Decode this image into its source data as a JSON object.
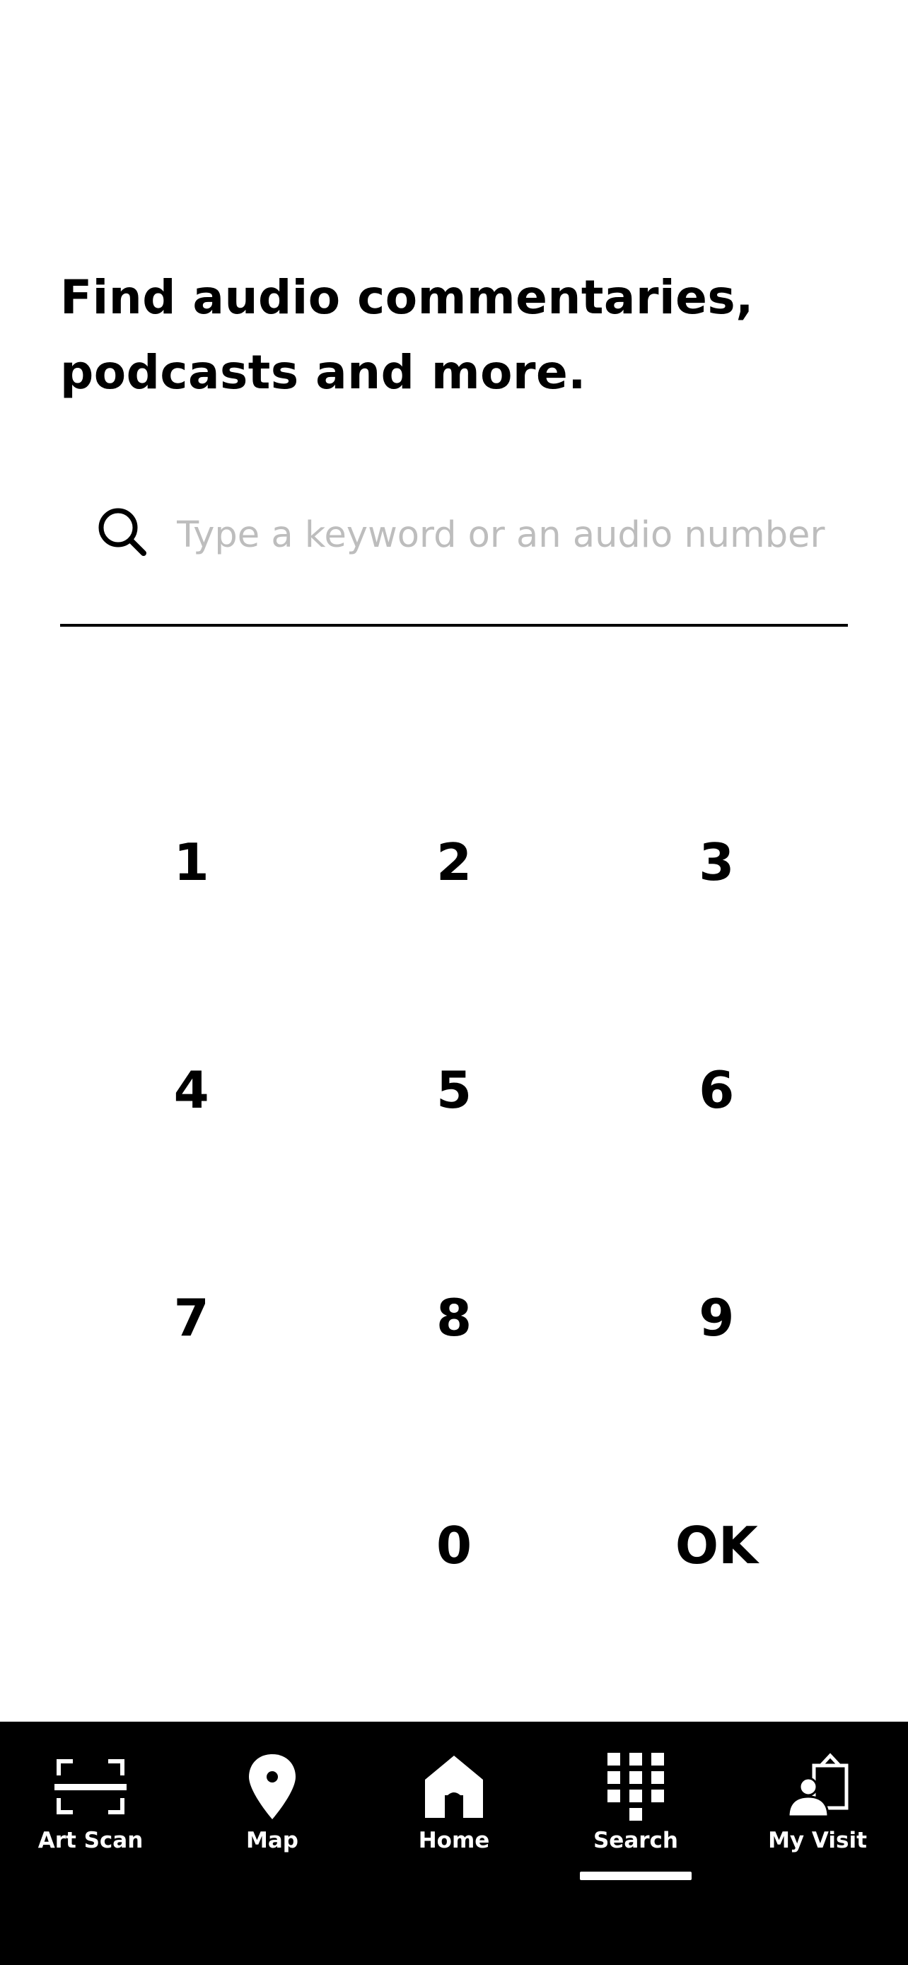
{
  "headline": "Find audio commentaries, podcasts and more.",
  "search": {
    "placeholder": "Type a keyword or an audio number",
    "icon": "search-icon"
  },
  "keypad": {
    "keys": [
      "1",
      "2",
      "3",
      "4",
      "5",
      "6",
      "7",
      "8",
      "9",
      "",
      "0",
      "OK"
    ]
  },
  "tabbar": {
    "active": "Search",
    "tabs": [
      {
        "label": "Art Scan",
        "icon": "scan-icon"
      },
      {
        "label": "Map",
        "icon": "map-pin-icon"
      },
      {
        "label": "Home",
        "icon": "home-icon"
      },
      {
        "label": "Search",
        "icon": "keypad-icon"
      },
      {
        "label": "My Visit",
        "icon": "person-board-icon"
      }
    ]
  }
}
